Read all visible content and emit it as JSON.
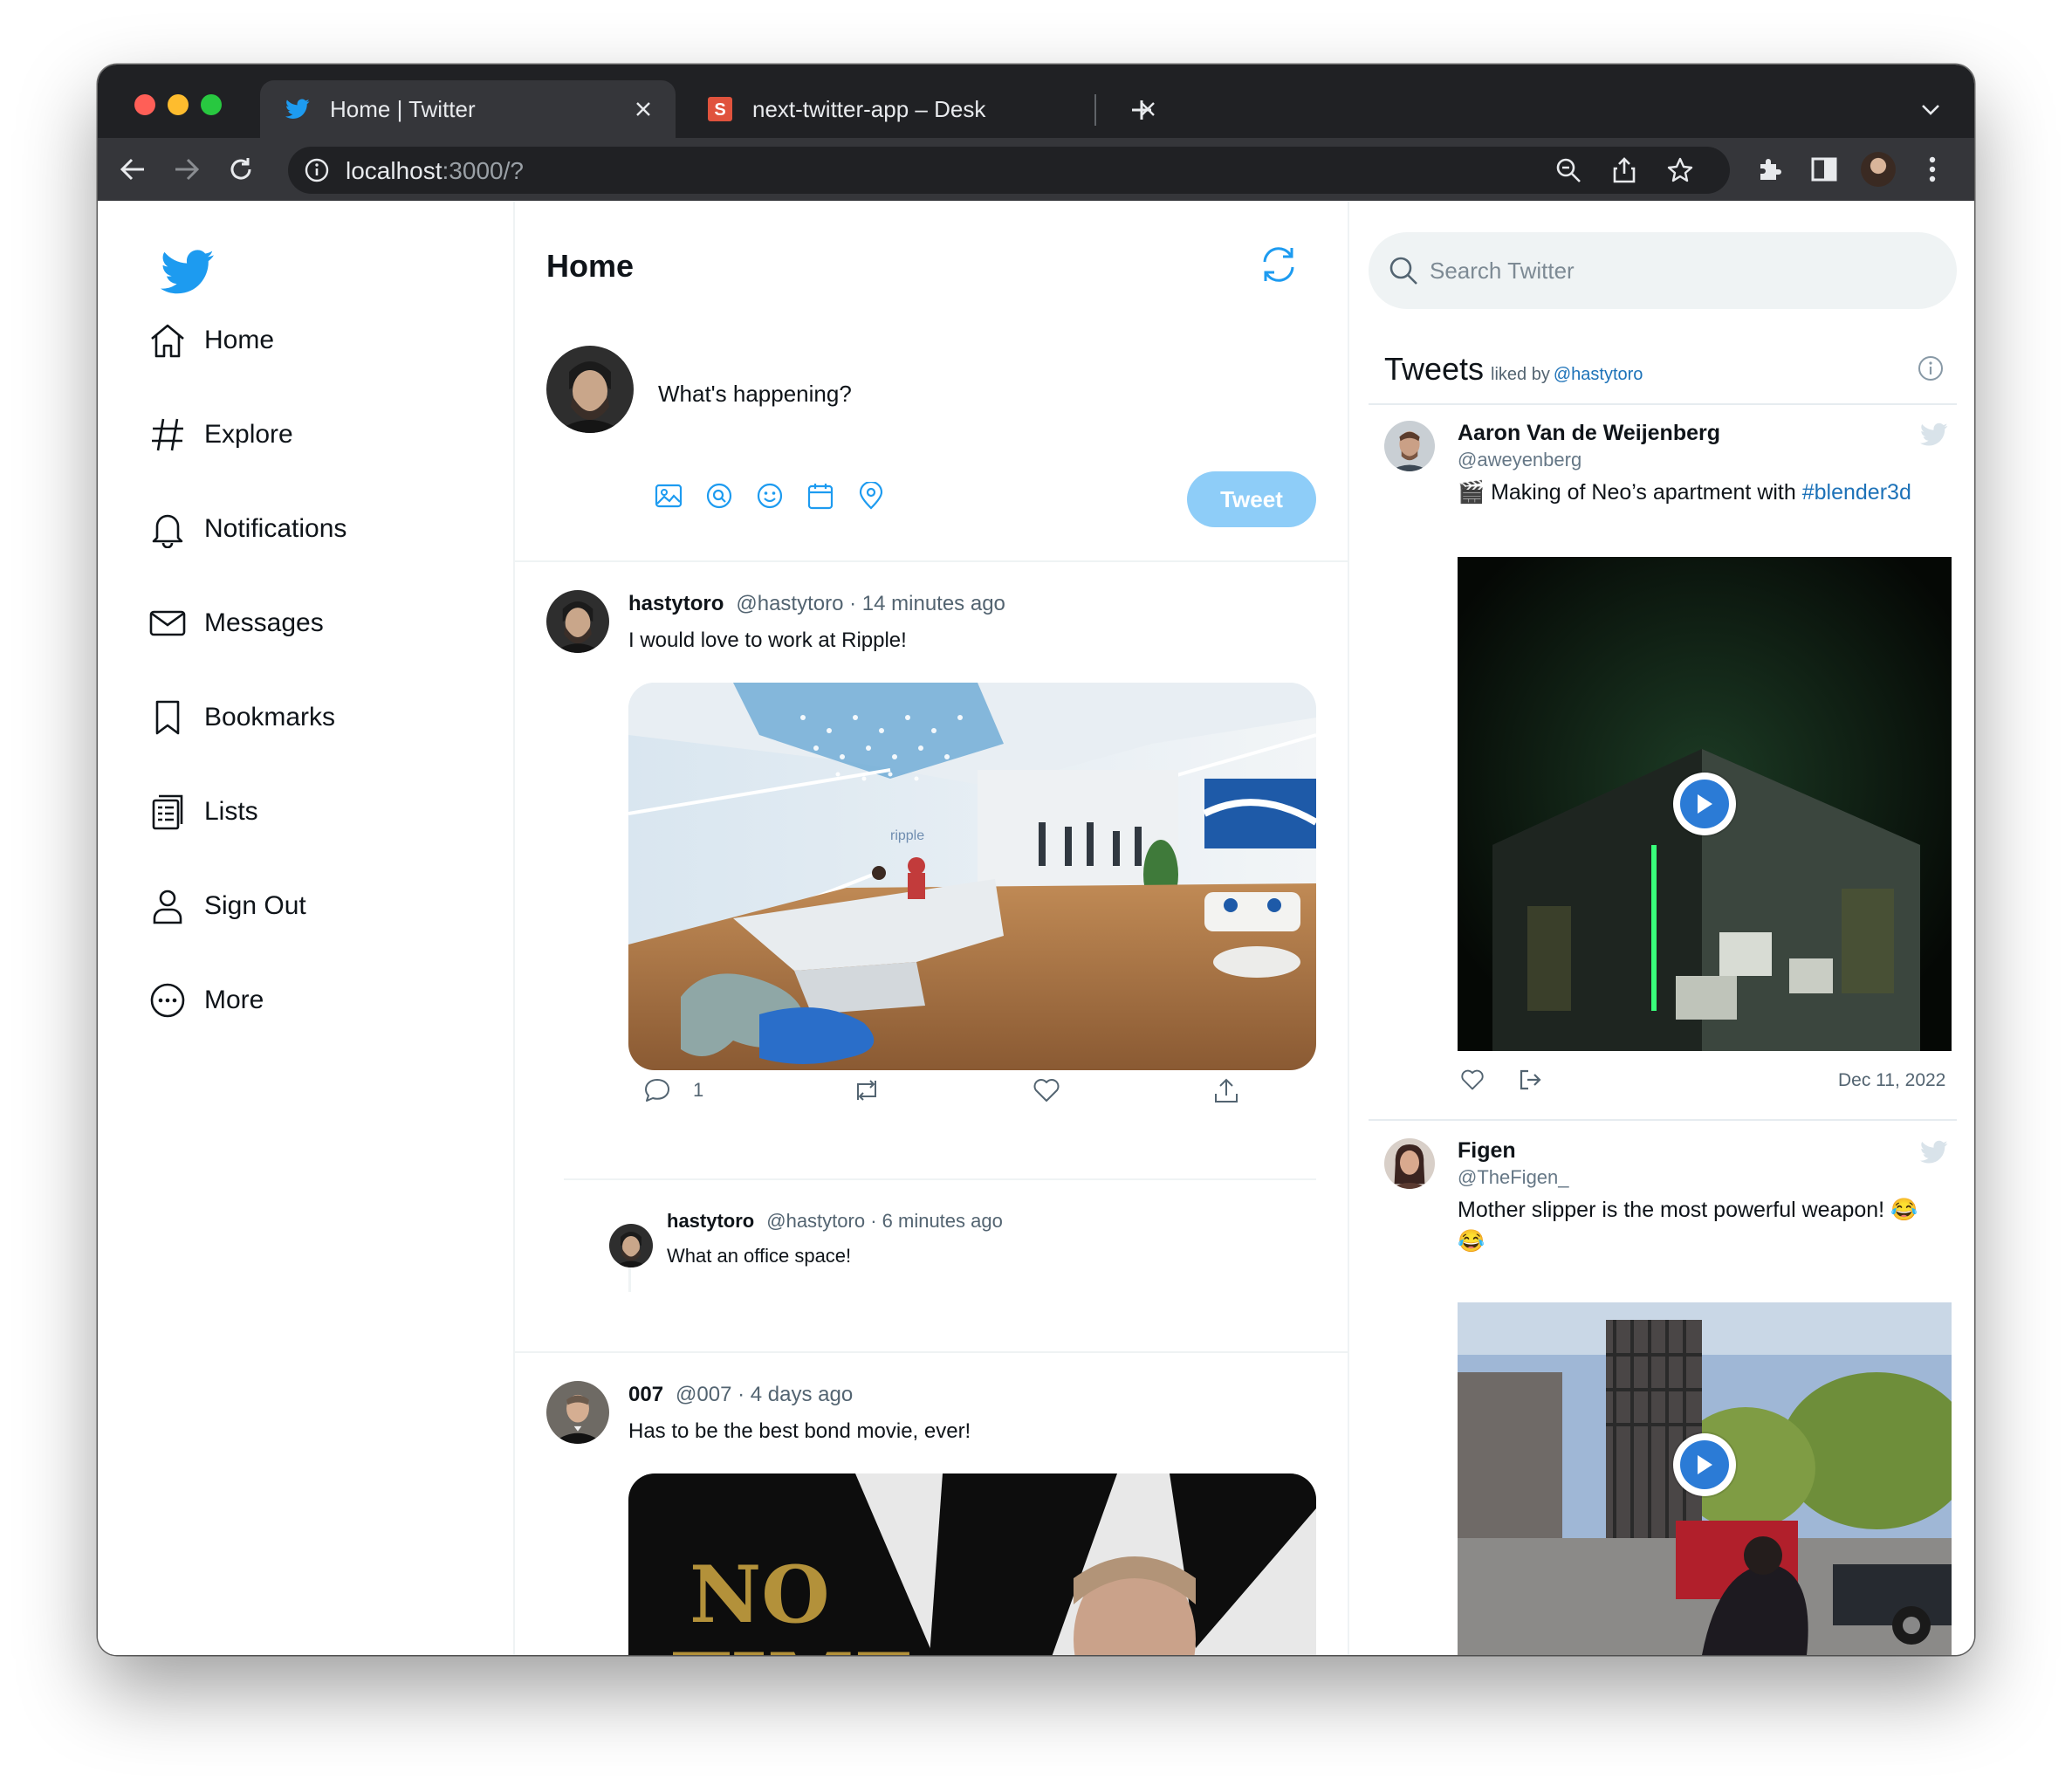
{
  "browser": {
    "tabs": [
      {
        "title": "Home | Twitter",
        "favicon": "twitter-bird-icon",
        "active": true
      },
      {
        "title": "next-twitter-app – Desk",
        "favicon": "s-app-icon",
        "active": false
      }
    ],
    "address": {
      "host": "localhost",
      "rest": ":3000/?"
    },
    "colors": {
      "frame": "#202124",
      "toolbar": "#35363a",
      "omnibox": "#202124"
    }
  },
  "sidebar": {
    "logo": "twitter-bird-icon",
    "items": [
      {
        "label": "Home",
        "icon": "home-icon"
      },
      {
        "label": "Explore",
        "icon": "hashtag-icon"
      },
      {
        "label": "Notifications",
        "icon": "bell-icon"
      },
      {
        "label": "Messages",
        "icon": "envelope-icon"
      },
      {
        "label": "Bookmarks",
        "icon": "bookmark-icon"
      },
      {
        "label": "Lists",
        "icon": "list-icon"
      },
      {
        "label": "Sign Out",
        "icon": "user-icon"
      },
      {
        "label": "More",
        "icon": "more-icon"
      }
    ]
  },
  "feed": {
    "title": "Home",
    "compose": {
      "placeholder": "What's happening?",
      "tweet_button": "Tweet",
      "tools": [
        "image-icon",
        "gif-icon",
        "emoji-icon",
        "schedule-icon",
        "location-icon"
      ]
    },
    "tweets": [
      {
        "name": "hastytoro",
        "handle": "@hastytoro",
        "time": "14 minutes ago",
        "text": "I would love to work at Ripple!",
        "reply_count": "1",
        "reply": {
          "name": "hastytoro",
          "handle": "@hastytoro",
          "time": "6 minutes ago",
          "text": "What an office space!"
        }
      },
      {
        "name": "007",
        "handle": "@007",
        "time": "4 days ago",
        "text": "Has to be the best bond movie, ever!"
      }
    ]
  },
  "right": {
    "search_placeholder": "Search Twitter",
    "liked": {
      "title": "Tweets",
      "by": "liked by",
      "handle": "@hastytoro"
    },
    "tweets": [
      {
        "name": "Aaron Van de Weijenberg",
        "handle": "@aweyenberg",
        "text": "🎬 Making of Neo’s apartment with ",
        "hashtag": "#blender3d",
        "date": "Dec 11, 2022"
      },
      {
        "name": "Figen",
        "handle": "@TheFigen_",
        "text": "Mother slipper is the most powerful weapon! 😂 😂"
      }
    ]
  },
  "colors": {
    "brand": "#1d9bf0",
    "tweet_button": "#8ecdf8",
    "link": "#1d72b8",
    "muted_text": "#536471"
  }
}
